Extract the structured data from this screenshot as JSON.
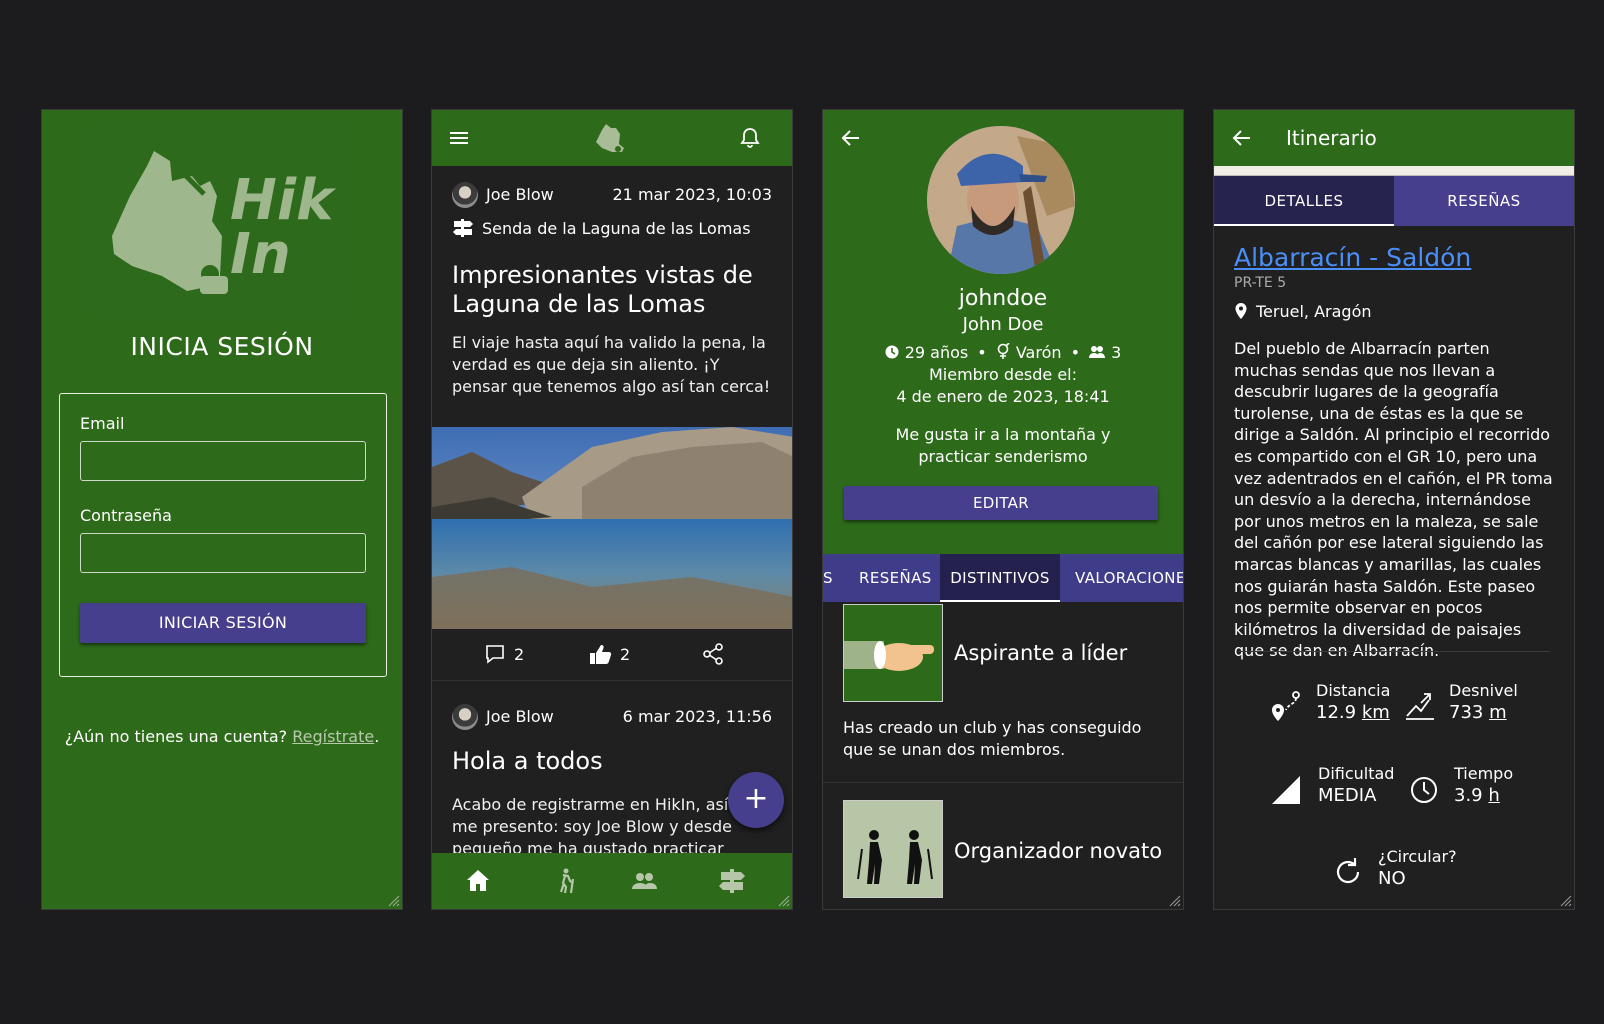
{
  "login": {
    "logo_text": "Hik In",
    "title": "INICIA SESIÓN",
    "email_label": "Email",
    "password_label": "Contraseña",
    "submit_label": "INICIAR SESIÓN",
    "signup_prompt": "¿Aún no tienes una cuenta?",
    "signup_link": "Regístrate",
    "signup_period": "."
  },
  "feed": {
    "posts": [
      {
        "author": "Joe Blow",
        "date": "21 mar 2023, 10:03",
        "trail": "Senda de la Laguna de las Lomas",
        "title": "Impresionantes vistas de Laguna de las Lomas",
        "body": "El viaje hasta aquí ha valido la pena, la verdad es que deja sin aliento. ¡Y pensar que tenemos algo así tan cerca!",
        "comments": "2",
        "likes": "2"
      },
      {
        "author": "Joe Blow",
        "date": "6 mar 2023, 11:56",
        "title": "Hola a todos",
        "body": "Acabo de registrarme en HikIn, así que me presento: soy Joe Blow y desde pequeño me ha gustado practicar senderismo"
      }
    ],
    "fab_label": "+"
  },
  "profile": {
    "username": "johndoe",
    "fullname": "John Doe",
    "age": "29 años",
    "gender": "Varón",
    "friends": "3",
    "member_since_label": "Miembro desde el:",
    "member_since": "4 de enero de 2023, 18:41",
    "bio": "Me gusta ir a la montaña y practicar senderismo",
    "edit_label": "EDITAR",
    "tabs": [
      "S",
      "RESEÑAS",
      "DISTINTIVOS",
      "VALORACIONE"
    ],
    "badges": [
      {
        "name": "Aspirante a líder",
        "description": "Has creado un club y has conseguido que se unan dos miembros."
      },
      {
        "name": "Organizador novato"
      }
    ]
  },
  "itinerary": {
    "header": "Itinerario",
    "tabs": [
      "DETALLES",
      "RESEÑAS"
    ],
    "title": "Albarracín - Saldón",
    "code": "PR-TE 5",
    "location": "Teruel, Aragón",
    "description": "Del pueblo de Albarracín parten muchas sendas que nos llevan a descubrir lugares de la geografía turolense, una de éstas es la que se dirige a Saldón. Al principio el recorrido es compartido con el GR 10, pero una vez adentrados en el cañón, el PR toma un desvío a la derecha, internándose por unos metros en la maleza, se sale del cañón por ese lateral siguiendo las marcas blancas y amarillas, las cuales nos guiarán hasta Saldón. Este paseo nos permite observar en pocos kilómetros la diversidad de paisajes que se dan en Albarracín.",
    "distance_label": "Distancia",
    "distance_value": "12.9",
    "distance_unit": "km",
    "elevation_label": "Desnivel",
    "elevation_value": "733",
    "elevation_unit": "m",
    "difficulty_label": "Dificultad",
    "difficulty_value": "MEDIA",
    "time_label": "Tiempo",
    "time_value": "3.9",
    "time_unit": "h",
    "circular_label": "¿Circular?",
    "circular_value": "NO"
  },
  "colors": {
    "green": "#2d6a1a",
    "purple": "#463f8d",
    "dark": "#202020",
    "page_bg": "#1c1c1f",
    "link": "#4a8ff7"
  }
}
